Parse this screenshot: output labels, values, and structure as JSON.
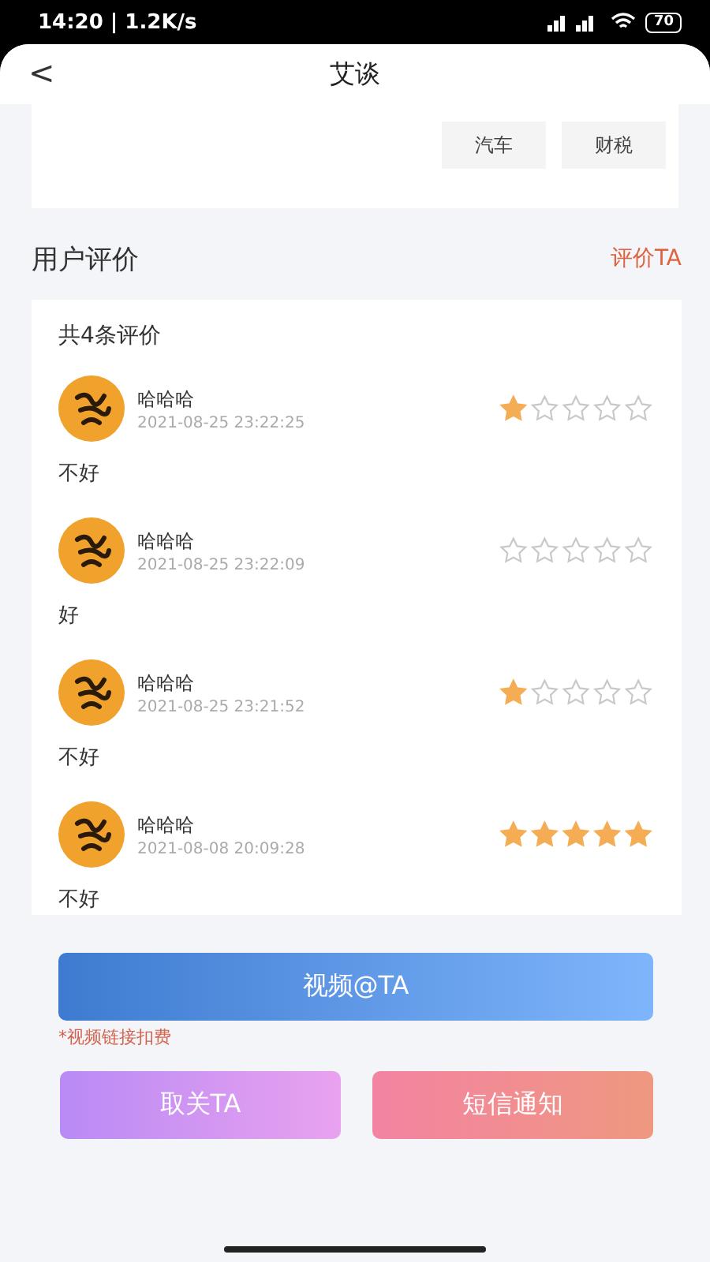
{
  "status_bar": {
    "time": "14:20 | 1.2K/s",
    "battery": "70"
  },
  "header": {
    "back": "<",
    "title": "艾谈"
  },
  "tags": [
    "汽车",
    "财税"
  ],
  "reviews_section": {
    "title": "用户评价",
    "action": "评价TA",
    "count": "共4条评价",
    "reviews": [
      {
        "name": "哈哈哈",
        "time": "2021-08-25 23:22:25",
        "stars": 1,
        "text": "不好"
      },
      {
        "name": "哈哈哈",
        "time": "2021-08-25 23:22:09",
        "stars": 0,
        "text": "好"
      },
      {
        "name": "哈哈哈",
        "time": "2021-08-25 23:21:52",
        "stars": 1,
        "text": "不好"
      },
      {
        "name": "哈哈哈",
        "time": "2021-08-08 20:09:28",
        "stars": 5,
        "text": "不好"
      }
    ]
  },
  "video_button": "视频@TA",
  "video_note": "*视频链接扣费",
  "buttons": [
    {
      "label": "取关TA",
      "kind": "unfollow"
    },
    {
      "label": "短信通知",
      "kind": "sms"
    }
  ]
}
